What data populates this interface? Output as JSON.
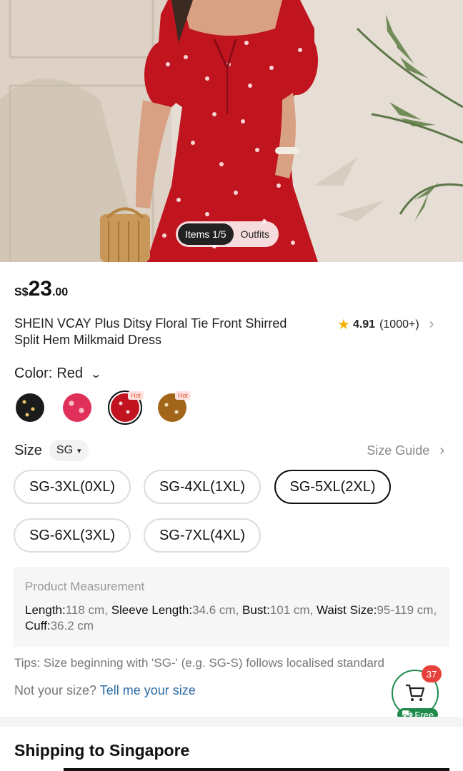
{
  "gallery": {
    "items_label": "Items 1/5",
    "outfits_label": "Outfits"
  },
  "price": {
    "currency": "S$",
    "integer": "23",
    "decimal": ".00"
  },
  "product": {
    "title": "SHEIN VCAY Plus Ditsy Floral Tie Front Shirred Split Hem Milkmaid Dress",
    "rating": "4.91",
    "review_count": "(1000+)"
  },
  "color": {
    "label": "Color:",
    "value": "Red",
    "hot_label": "Hot",
    "swatches": [
      {
        "color": "#1b1b1b",
        "accent": "#e9c36a",
        "hot": false,
        "selected": false
      },
      {
        "color": "#e0305a",
        "accent": "#f7c0c9",
        "hot": false,
        "selected": false
      },
      {
        "color": "#c1121f",
        "accent": "#f4d4d4",
        "hot": true,
        "selected": true
      },
      {
        "color": "#a2651a",
        "accent": "#f3e2c0",
        "hot": true,
        "selected": false
      }
    ]
  },
  "size": {
    "label": "Size",
    "region": "SG",
    "guide_label": "Size Guide",
    "options": [
      "SG-3XL(0XL)",
      "SG-4XL(1XL)",
      "SG-5XL(2XL)",
      "SG-6XL(3XL)",
      "SG-7XL(4XL)"
    ],
    "selected": "SG-5XL(2XL)"
  },
  "measurement": {
    "heading": "Product Measurement",
    "length_k": "Length:",
    "length_v": "118 cm,",
    "sleeve_k": "Sleeve Length:",
    "sleeve_v": "34.6 cm,",
    "bust_k": "Bust:",
    "bust_v": "101 cm,",
    "waist_k": "Waist Size:",
    "waist_v": "95-119 cm,",
    "cuff_k": "Cuff:",
    "cuff_v": "36.2 cm"
  },
  "tips": "Tips: Size beginning with 'SG-' (e.g. SG-S) follows localised standard",
  "not_your_size": {
    "prefix": "Not your size?",
    "link": "Tell me your size"
  },
  "cart": {
    "count": "37",
    "free_label": "Free"
  },
  "shipping_heading": "Shipping to Singapore"
}
